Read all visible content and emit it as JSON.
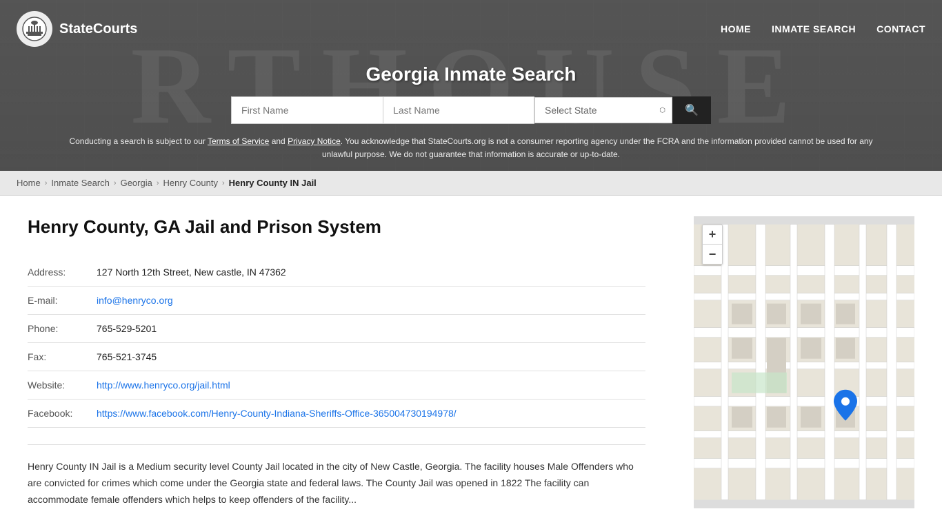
{
  "site": {
    "logo_text": "StateCourts",
    "logo_icon_alt": "courthouse-columns-icon"
  },
  "nav": {
    "home_label": "HOME",
    "inmate_search_label": "INMATE SEARCH",
    "contact_label": "CONTACT"
  },
  "header": {
    "title": "Georgia Inmate Search",
    "deco_text": "RTHOUSE"
  },
  "search": {
    "first_name_placeholder": "First Name",
    "last_name_placeholder": "Last Name",
    "state_select_label": "Select State",
    "search_icon": "🔍"
  },
  "disclaimer": {
    "text_before": "Conducting a search is subject to our ",
    "terms_label": "Terms of Service",
    "and": " and ",
    "privacy_label": "Privacy Notice",
    "text_after": ". You acknowledge that StateCourts.org is not a consumer reporting agency under the FCRA and the information provided cannot be used for any unlawful purpose. We do not guarantee that information is accurate or up-to-date."
  },
  "breadcrumb": {
    "home": "Home",
    "inmate_search": "Inmate Search",
    "georgia": "Georgia",
    "henry_county": "Henry County",
    "current": "Henry County IN Jail"
  },
  "facility": {
    "page_title": "Henry County, GA Jail and Prison System",
    "address_label": "Address:",
    "address_value": "127 North 12th Street, New castle, IN 47362",
    "email_label": "E-mail:",
    "email_value": "info@henryco.org",
    "phone_label": "Phone:",
    "phone_value": "765-529-5201",
    "fax_label": "Fax:",
    "fax_value": "765-521-3745",
    "website_label": "Website:",
    "website_value": "http://www.henryco.org/jail.html",
    "facebook_label": "Facebook:",
    "facebook_value": "https://www.facebook.com/Henry-County-Indiana-Sheriffs-Office-365004730194978/",
    "description": "Henry County IN Jail is a Medium security level County Jail located in the city of New Castle, Georgia. The facility houses Male Offenders who are convicted for crimes which come under the Georgia state and federal laws. The County Jail was opened in 1822 The facility can accommodate female offenders which helps to keep offenders of the facility..."
  },
  "map": {
    "zoom_in": "+",
    "zoom_out": "−"
  }
}
